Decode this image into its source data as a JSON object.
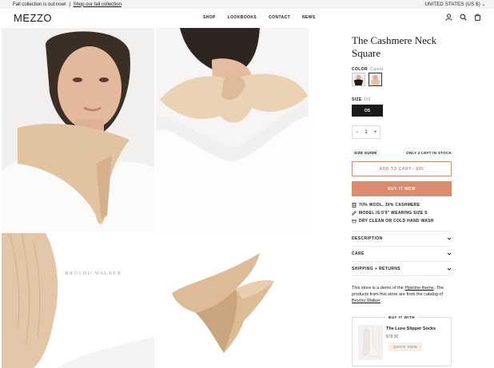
{
  "announcement": {
    "left_text": "Fall collection is out now!",
    "separator": "|",
    "link_text": "Shop our fall collection",
    "currency": "UNITED STATES (US $)"
  },
  "header": {
    "logo": "MEZZO",
    "nav": [
      "SHOP",
      "LOOKBOOKS",
      "CONTACT",
      "NEWS"
    ],
    "icons": [
      "account-icon",
      "search-icon",
      "cart-icon"
    ]
  },
  "gallery": {
    "images": [
      "woman-wearing-scarf",
      "scarf-tied-neck-back",
      "scarf-packaging-box",
      "scarf-floating"
    ],
    "box_text": "BROCHU WALKER"
  },
  "product": {
    "title": "The Cashmere Neck Square",
    "color_label": "COLOR",
    "color_value": "Camel",
    "colors": [
      {
        "name": "Black",
        "hex": "#1b1b1b"
      },
      {
        "name": "Camel",
        "hex": "#e4c6a6"
      }
    ],
    "size_label": "SIZE",
    "size_value": "OS",
    "size_option": "OS",
    "quantity": "1",
    "qty_minus": "−",
    "qty_plus": "+",
    "size_guide": "SIZE GUIDE",
    "stock": "ONLY 2 LEFT IN STOCK",
    "add_to_cart": "ADD TO CART · $95",
    "buy_now": "BUY IT NOW",
    "features": [
      "70% WOOL, 30% CASHMERE",
      "MODEL IS 5'9\" WEARING SIZE S",
      "DRY CLEAN OR COLD HAND WASH"
    ],
    "accordions": [
      "DESCRIPTION",
      "CARE",
      "SHIPPING + RETURNS"
    ],
    "description_1": "This store is a demo of the",
    "description_link_1": "Pipeline theme",
    "description_2": ". The products from this store are from the catalog of",
    "description_link_2": "Brochu Walker"
  },
  "buy_it_with": {
    "title": "BUY IT WITH",
    "name": "The Luxe Slipper Socks",
    "price": "$78.00",
    "button": "QUICK VIEW"
  },
  "colors": {
    "accent": "#d98b6c",
    "dark": "#1a1a1a",
    "announcement_bg": "#f3f3f3"
  }
}
